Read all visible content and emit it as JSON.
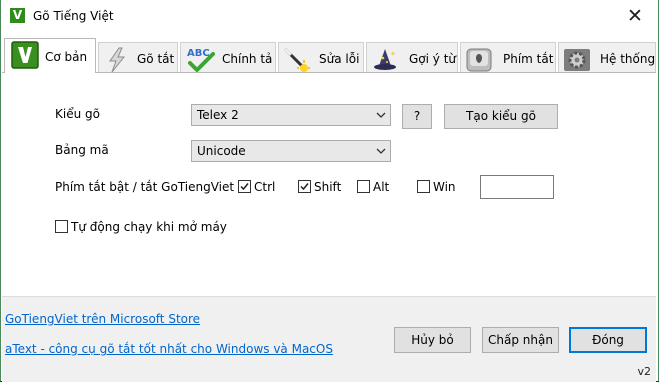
{
  "window": {
    "title": "Gõ Tiếng Việt",
    "app_icon_letter": "V",
    "icon_name": "app-logo-icon"
  },
  "tabs": [
    {
      "label": "Cơ bản",
      "icon": "v-logo-icon",
      "active": true
    },
    {
      "label": "Gõ tắt",
      "icon": "lightning-icon",
      "active": false
    },
    {
      "label": "Chính tả",
      "icon": "abc-check-icon",
      "active": false
    },
    {
      "label": "Sửa lỗi",
      "icon": "magic-wand-icon",
      "active": false
    },
    {
      "label": "Gợi ý từ",
      "icon": "wizard-hat-icon",
      "active": false
    },
    {
      "label": "Phím tắt",
      "icon": "keyboard-key-icon",
      "active": false
    },
    {
      "label": "Hệ thống",
      "icon": "gear-icon",
      "active": false
    }
  ],
  "form": {
    "typing_method_label": "Kiểu gõ",
    "typing_method_value": "Telex 2",
    "help_button": "?",
    "create_method_button": "Tạo kiểu gõ",
    "charset_label": "Bảng mã",
    "charset_value": "Unicode",
    "hotkey_label": "Phím tắt bật / tắt GoTiengViet",
    "hotkeys": [
      {
        "label": "Ctrl",
        "checked": true
      },
      {
        "label": "Shift",
        "checked": true
      },
      {
        "label": "Alt",
        "checked": false
      },
      {
        "label": "Win",
        "checked": false
      }
    ],
    "hotkey_key_value": "",
    "autostart_label": "Tự động chạy khi mở máy",
    "autostart_checked": false
  },
  "footer": {
    "link_store": "GoTiengViet trên Microsoft Store",
    "link_atext": "aText - công cụ gõ tắt tốt nhất cho Windows và MacOS",
    "cancel_button": "Hủy bỏ",
    "accept_button": "Chấp nhận",
    "close_button": "Đóng",
    "version": "v2"
  },
  "colors": {
    "accent": "#0078d7",
    "brand_green": "#2e8b1c",
    "link": "#0066cc"
  }
}
